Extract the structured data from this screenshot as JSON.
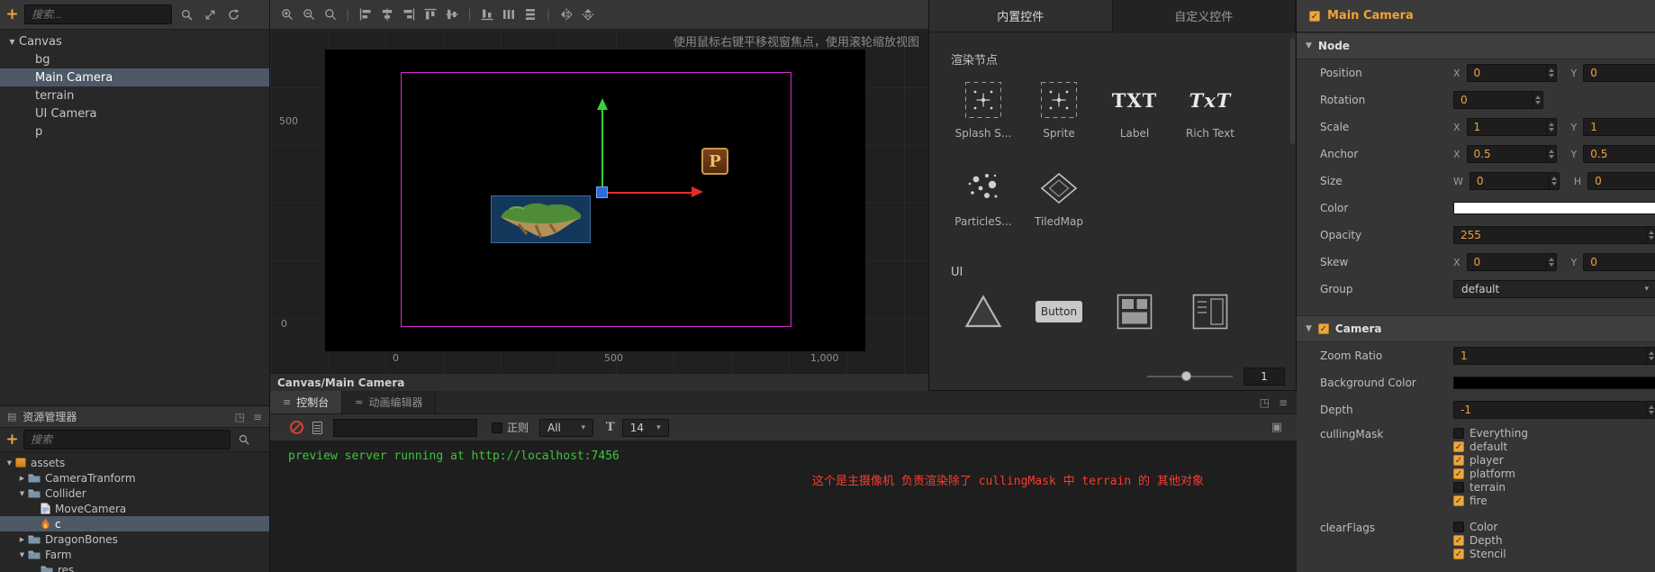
{
  "icons": {
    "plus": "+",
    "caret_down": "▼",
    "caret_right": "▶",
    "caret_small": "▾",
    "check": "✓",
    "menu": "≡",
    "float_window": "◳",
    "maximize": "▣",
    "panel_grid": "▤",
    "wave": "≈",
    "text_size": "T",
    "pipe": "|"
  },
  "hierarchy": {
    "search_placeholder": "搜索...",
    "items": [
      {
        "label": "Canvas",
        "depth": 0,
        "expanded": true
      },
      {
        "label": "bg",
        "depth": 1
      },
      {
        "label": "Main Camera",
        "depth": 1,
        "selected": true
      },
      {
        "label": "terrain",
        "depth": 1
      },
      {
        "label": "UI Camera",
        "depth": 1
      },
      {
        "label": "p",
        "depth": 1
      }
    ]
  },
  "assets": {
    "title": "资源管理器",
    "search_placeholder": "搜索",
    "items": [
      {
        "label": "assets",
        "icon": "bundle",
        "twisty": "open",
        "depth": 0
      },
      {
        "label": "CameraTranform",
        "icon": "folder",
        "twisty": "closed",
        "depth": 1
      },
      {
        "label": "Collider",
        "icon": "folder",
        "twisty": "open",
        "depth": 1
      },
      {
        "label": "MoveCamera",
        "icon": "script",
        "twisty": "none",
        "depth": 2
      },
      {
        "label": "c",
        "icon": "fire",
        "twisty": "none",
        "depth": 2,
        "selected": true
      },
      {
        "label": "DragonBones",
        "icon": "folder",
        "twisty": "closed",
        "depth": 1
      },
      {
        "label": "Farm",
        "icon": "folder",
        "twisty": "open",
        "depth": 1
      },
      {
        "label": "res",
        "icon": "folder",
        "twisty": "none",
        "depth": 2
      }
    ]
  },
  "scene": {
    "toolbar": [
      "zoom-in",
      "zoom-out",
      "zoom-reset",
      "sep",
      "align-left",
      "align-h-center",
      "align-right",
      "align-top",
      "align-v-center",
      "sep",
      "align-bottom",
      "distribute-h",
      "distribute-v",
      "sep",
      "flip-h",
      "flip-v"
    ],
    "hint": "使用鼠标右键平移视窗焦点，使用滚轮缩放视图",
    "breadcrumb": "Canvas/Main Camera",
    "sprite_letter": "P",
    "ruler_left": [
      "500",
      "0"
    ],
    "ruler_bottom": [
      "0",
      "500",
      "1,000"
    ]
  },
  "library": {
    "tabs": [
      {
        "label": "内置控件",
        "active": true
      },
      {
        "label": "自定义控件",
        "active": false
      }
    ],
    "sections": [
      {
        "title": "渲染节点",
        "items": [
          {
            "icon": "sprite-box",
            "label": "Splash S..."
          },
          {
            "icon": "sprite-box",
            "label": "Sprite"
          },
          {
            "icon": "txt",
            "label": "Label"
          },
          {
            "icon": "richtext",
            "label": "Rich Text"
          },
          {
            "icon": "particles",
            "label": "ParticleS..."
          },
          {
            "icon": "tiledmap",
            "label": "TiledMap"
          }
        ]
      },
      {
        "title": "UI",
        "items": [
          {
            "icon": "triangle",
            "label": ""
          },
          {
            "icon": "button",
            "label": ""
          },
          {
            "icon": "layout-grid",
            "label": ""
          },
          {
            "icon": "layout-panel",
            "label": ""
          }
        ]
      }
    ],
    "label_icon_text": "TXT",
    "richtext_icon_text": "TxT",
    "button_label": "Button",
    "zoom_value": "1"
  },
  "console": {
    "tabs": [
      {
        "label": "控制台",
        "active": true
      },
      {
        "label": "动画编辑器",
        "active": false
      }
    ],
    "regex_label": "正则",
    "level_value": "All",
    "fontsize_value": "14",
    "logs": [
      {
        "text": "preview server running at http://localhost:7456",
        "color": "green"
      },
      {
        "text": "这个是主摄像机 负责渲染除了 cullingMask 中 terrain 的 其他对象",
        "color": "red"
      }
    ]
  },
  "inspector": {
    "node_name": "Main Camera",
    "sections": {
      "node": {
        "title": "Node"
      },
      "camera": {
        "title": "Camera"
      }
    },
    "node_rows": [
      {
        "label": "Position",
        "type": "pair",
        "k1": "X",
        "v1": "0",
        "k2": "Y",
        "v2": "0"
      },
      {
        "label": "Rotation",
        "type": "single",
        "v1": "0"
      },
      {
        "label": "Scale",
        "type": "pair",
        "k1": "X",
        "v1": "1",
        "k2": "Y",
        "v2": "1"
      },
      {
        "label": "Anchor",
        "type": "pair",
        "k1": "X",
        "v1": "0.5",
        "k2": "Y",
        "v2": "0.5"
      },
      {
        "label": "Size",
        "type": "pair",
        "k1": "W",
        "v1": "0",
        "k2": "H",
        "v2": "0"
      },
      {
        "label": "Color",
        "type": "color",
        "swatch": "#ffffff"
      },
      {
        "label": "Opacity",
        "type": "wide",
        "v1": "255"
      },
      {
        "label": "Skew",
        "type": "pair",
        "k1": "X",
        "v1": "0",
        "k2": "Y",
        "v2": "0"
      },
      {
        "label": "Group",
        "type": "dropdown",
        "v1": "default"
      }
    ],
    "camera_rows": [
      {
        "label": "Zoom Ratio",
        "type": "wide",
        "v1": "1"
      },
      {
        "label": "Background Color",
        "type": "color",
        "swatch": "#000000"
      },
      {
        "label": "Depth",
        "type": "wide",
        "v1": "-1"
      },
      {
        "label": "cullingMask",
        "type": "checks",
        "checks": [
          {
            "label": "Everything",
            "checked": false
          },
          {
            "label": "default",
            "checked": true
          },
          {
            "label": "player",
            "checked": true
          },
          {
            "label": "platform",
            "checked": true
          },
          {
            "label": "terrain",
            "checked": false
          },
          {
            "label": "fire",
            "checked": true
          }
        ]
      },
      {
        "label": "clearFlags",
        "type": "checks",
        "checks": [
          {
            "label": "Color",
            "checked": false
          },
          {
            "label": "Depth",
            "checked": true
          },
          {
            "label": "Stencil",
            "checked": true
          }
        ]
      }
    ]
  }
}
